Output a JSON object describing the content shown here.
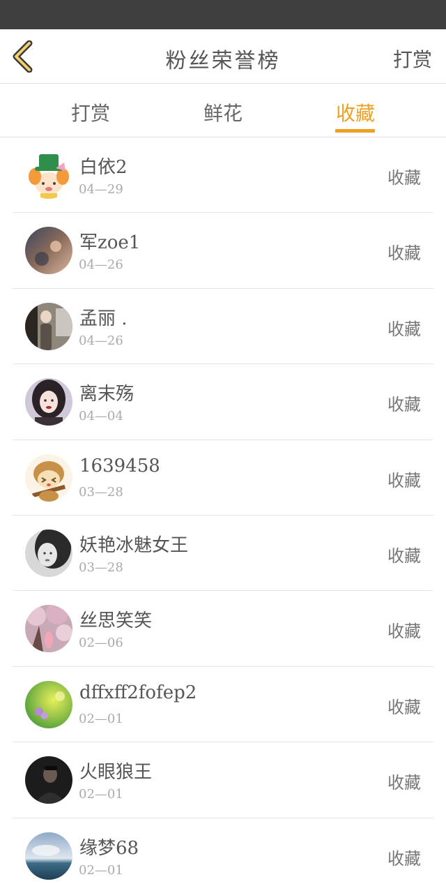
{
  "header": {
    "title": "粉丝荣誉榜",
    "right_label": "打赏"
  },
  "tabs": [
    {
      "label": "打赏",
      "active": false
    },
    {
      "label": "鲜花",
      "active": false
    },
    {
      "label": "收藏",
      "active": true
    }
  ],
  "colors": {
    "accent": "#f0a020",
    "statusbar": "#3f3f3f"
  },
  "fans": [
    {
      "name": "白依2",
      "date": "04—29",
      "action": "收藏",
      "avatar": "cartoon-clown-avatar"
    },
    {
      "name": "军zoe1",
      "date": "04—26",
      "action": "收藏",
      "avatar": "photo-avatar"
    },
    {
      "name": "孟丽 .",
      "date": "04—26",
      "action": "收藏",
      "avatar": "photo-avatar"
    },
    {
      "name": "离末殇",
      "date": "04—04",
      "action": "收藏",
      "avatar": "photo-avatar"
    },
    {
      "name": "1639458",
      "date": "03—28",
      "action": "收藏",
      "avatar": "cartoon-monkey-avatar"
    },
    {
      "name": "妖艳冰魅女王",
      "date": "03—28",
      "action": "收藏",
      "avatar": "photo-avatar"
    },
    {
      "name": "丝思笑笑",
      "date": "02—06",
      "action": "收藏",
      "avatar": "photo-avatar"
    },
    {
      "name": "dffxff2fofep2",
      "date": "02—01",
      "action": "收藏",
      "avatar": "photo-avatar"
    },
    {
      "name": "火眼狼王",
      "date": "02—01",
      "action": "收藏",
      "avatar": "photo-avatar"
    },
    {
      "name": "缘梦68",
      "date": "02—01",
      "action": "收藏",
      "avatar": "photo-avatar"
    }
  ]
}
